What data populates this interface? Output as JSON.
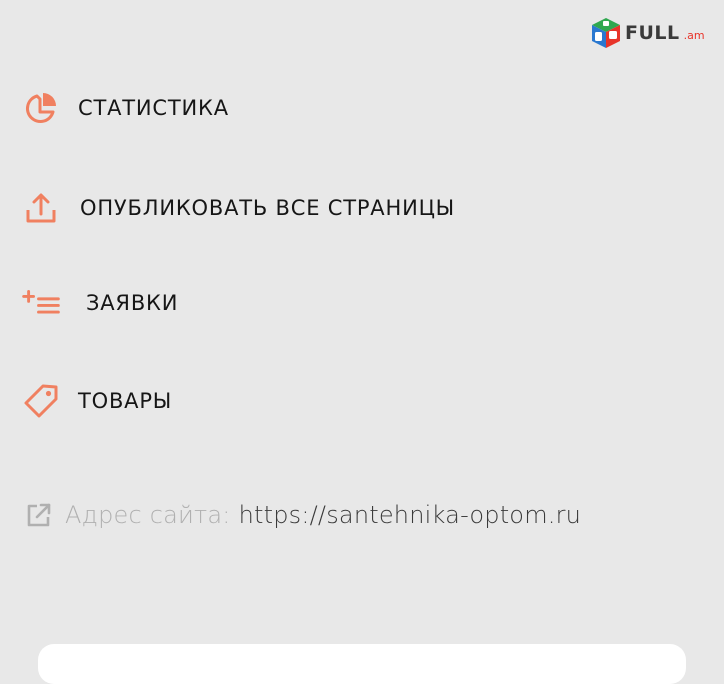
{
  "logo": {
    "text": "FULL",
    "suffix": ".am",
    "icon": "full-am-cube-logo"
  },
  "menu": {
    "items": [
      {
        "label": "СТАТИСТИКА",
        "icon": "pie-chart-icon"
      },
      {
        "label": "ОПУБЛИКОВАТЬ ВСЕ СТРАНИЦЫ",
        "icon": "upload-icon"
      },
      {
        "label": "ЗАЯВКИ",
        "icon": "add-list-icon"
      },
      {
        "label": "ТОВАРЫ",
        "icon": "tag-icon"
      }
    ]
  },
  "site": {
    "label": "Адрес сайта:",
    "url": "https://santehnika-optom.ru",
    "icon": "external-link-icon"
  },
  "colors": {
    "accent": "#f08060",
    "text": "#161616",
    "muted": "#b0b0b0",
    "background": "#e8e8e8",
    "logo_red": "#e8342a",
    "logo_green": "#2fa84f",
    "logo_blue": "#2a78d0"
  }
}
